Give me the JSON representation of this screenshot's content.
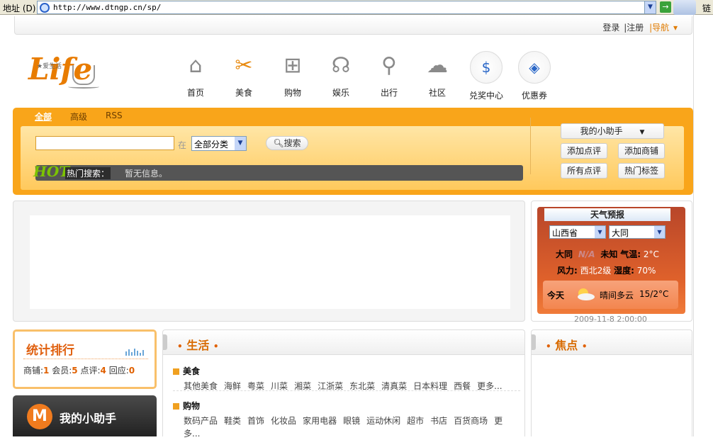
{
  "browser": {
    "address_label": "地址 (D)",
    "url": "http://www.dtngp.cn/sp/",
    "links_label": "链"
  },
  "topbar": {
    "login": "登录",
    "register": "|注册",
    "nav": "|导航"
  },
  "logo": {
    "text": "Life",
    "tagline": "★爱生活"
  },
  "nav": {
    "items": [
      {
        "label": "首页",
        "icon": "home-icon",
        "glyph": "⌂"
      },
      {
        "label": "美食",
        "icon": "fork-knife-icon",
        "glyph": "✂"
      },
      {
        "label": "购物",
        "icon": "shopping-cart-icon",
        "glyph": "⊞"
      },
      {
        "label": "娱乐",
        "icon": "headphones-icon",
        "glyph": "☊"
      },
      {
        "label": "出行",
        "icon": "bicycle-icon",
        "glyph": "⚲"
      },
      {
        "label": "社区",
        "icon": "chat-bubbles-icon",
        "glyph": "☁"
      },
      {
        "label": "兑奖中心",
        "icon": "prize-house-icon",
        "glyph": "$"
      },
      {
        "label": "优惠券",
        "icon": "sale-tag-icon",
        "glyph": "◈"
      }
    ]
  },
  "search": {
    "tabs": [
      "全部",
      "高级",
      "RSS"
    ],
    "in_label": "在",
    "category": "全部分类",
    "button": "搜索",
    "hot_badge": "HOT",
    "hot_label": "热门搜索：",
    "hot_empty": "暂无信息。"
  },
  "assistant": {
    "dropdown": "我的小助手",
    "buttons": [
      "添加点评",
      "添加商铺",
      "所有点评",
      "热门标签"
    ]
  },
  "weather": {
    "title": "天气预报",
    "province": "山西省",
    "city": "大同",
    "line1_city": "大同",
    "line1_na": "N/A",
    "line1_unknown": "未知",
    "line1_temp_label": "气温:",
    "line1_temp": "2°C",
    "line2_wind_label": "风力:",
    "line2_wind": "西北2级",
    "line2_hum_label": "湿度:",
    "line2_hum": "70%",
    "today_label": "今天",
    "today_desc": "晴间多云",
    "today_temp": "15/2°C",
    "date": "2009-11-8 2:00:00"
  },
  "stats": {
    "title": "统计排行",
    "shops_label": "商铺:",
    "shops": "1",
    "members_label": "会员:",
    "members": "5",
    "reviews_label": "点评:",
    "reviews": "4",
    "replies_label": "回应:",
    "replies": "0"
  },
  "helper": {
    "badge": "M",
    "title": "我的小助手"
  },
  "life": {
    "title": "生活",
    "categories": [
      {
        "name": "美食",
        "items": [
          "其他美食",
          "海鲜",
          "粤菜",
          "川菜",
          "湘菜",
          "江浙菜",
          "东北菜",
          "清真菜",
          "日本料理",
          "西餐",
          "更多..."
        ]
      },
      {
        "name": "购物",
        "items": [
          "数码产品",
          "鞋类",
          "首饰",
          "化妆品",
          "家用电器",
          "眼镜",
          "运动休闲",
          "超市",
          "书店",
          "百货商场",
          "更",
          "多..."
        ]
      }
    ]
  },
  "focus": {
    "title": "焦点"
  }
}
